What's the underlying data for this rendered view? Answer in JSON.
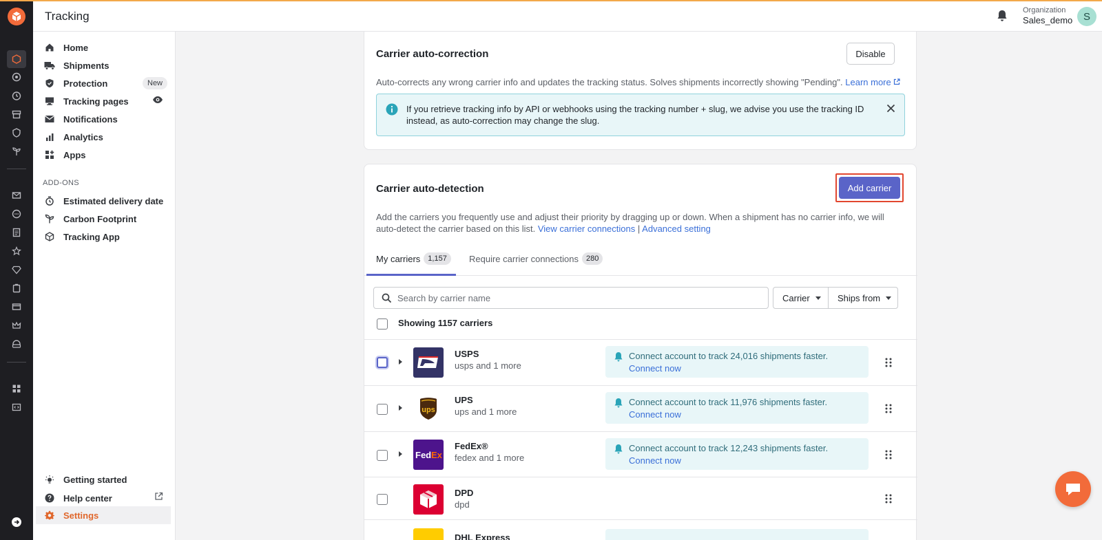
{
  "header": {
    "title": "Tracking",
    "org_label": "Organization",
    "org_name": "Sales_demo",
    "avatar_initial": "S"
  },
  "sidebar": {
    "items": [
      {
        "label": "Home",
        "icon": "home-icon"
      },
      {
        "label": "Shipments",
        "icon": "truck-icon"
      },
      {
        "label": "Protection",
        "icon": "shield-icon",
        "badge": "New"
      },
      {
        "label": "Tracking pages",
        "icon": "monitor-icon",
        "trail_icon": "eye-icon"
      },
      {
        "label": "Notifications",
        "icon": "mail-icon"
      },
      {
        "label": "Analytics",
        "icon": "bar-chart-icon"
      },
      {
        "label": "Apps",
        "icon": "apps-grid-icon"
      }
    ],
    "addons_label": "ADD-ONS",
    "addons": [
      {
        "label": "Estimated delivery date",
        "icon": "stopwatch-icon"
      },
      {
        "label": "Carbon Footprint",
        "icon": "plant-icon"
      },
      {
        "label": "Tracking App",
        "icon": "package-icon"
      }
    ],
    "footer": [
      {
        "label": "Getting started",
        "icon": "bulb-icon"
      },
      {
        "label": "Help center",
        "icon": "help-icon",
        "trail_icon": "external-link-icon"
      },
      {
        "label": "Settings",
        "icon": "gear-icon"
      }
    ]
  },
  "autocorrection": {
    "title": "Carrier auto-correction",
    "disable_label": "Disable",
    "description": "Auto-corrects any wrong carrier info and updates the tracking status. Solves shipments incorrectly showing \"Pending\".",
    "learn_more": "Learn more",
    "info_text": "If you retrieve tracking info by API or webhooks using the tracking number + slug, we advise you use the tracking ID instead, as auto-correction may change the slug."
  },
  "autodetection": {
    "title": "Carrier auto-detection",
    "add_carrier_label": "Add carrier",
    "description": "Add the carriers you frequently use and adjust their priority by dragging up or down. When a shipment has no carrier info, we will auto-detect the carrier based on this list.",
    "view_connections": "View carrier connections",
    "separator": "|",
    "advanced_setting": "Advanced setting",
    "tabs": [
      {
        "label": "My carriers",
        "count": "1,157"
      },
      {
        "label": "Require carrier connections",
        "count": "280"
      }
    ],
    "search_placeholder": "Search by carrier name",
    "filter_carrier": "Carrier",
    "filter_ships_from": "Ships from",
    "showing": "Showing 1157 carriers",
    "carriers": [
      {
        "name": "USPS",
        "slug": "usps and 1 more",
        "notice": "Connect account to track 24,016 shipments faster.",
        "connect": "Connect now"
      },
      {
        "name": "UPS",
        "slug": "ups and 1 more",
        "notice": "Connect account to track 11,976 shipments faster.",
        "connect": "Connect now"
      },
      {
        "name": "FedEx®",
        "slug": "fedex and 1 more",
        "notice": "Connect account to track 12,243 shipments faster.",
        "connect": "Connect now"
      },
      {
        "name": "DPD",
        "slug": "dpd"
      },
      {
        "name": "DHL Express",
        "slug": ""
      }
    ]
  },
  "colors": {
    "accent": "#5a64c8",
    "brand_orange": "#f26b3a",
    "info_bg": "#e8f6f8",
    "highlight": "#e2462f"
  }
}
